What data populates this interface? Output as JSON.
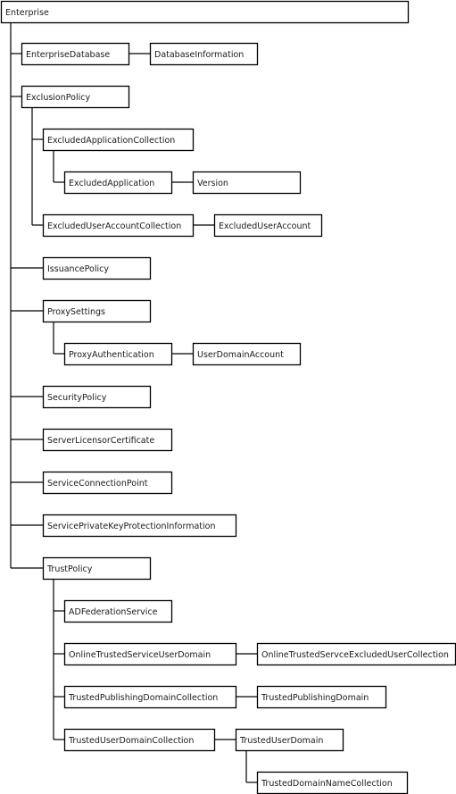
{
  "diagram": {
    "title": "Enterprise",
    "nodes": [
      {
        "id": "enterprise",
        "label": "Enterprise",
        "parent": null
      },
      {
        "id": "enterprise-database",
        "label": "EnterpriseDatabase",
        "parent": "enterprise"
      },
      {
        "id": "database-information",
        "label": "DatabaseInformation",
        "parent": "enterprise-database"
      },
      {
        "id": "exclusion-policy",
        "label": "ExclusionPolicy",
        "parent": "enterprise"
      },
      {
        "id": "excluded-application-collection",
        "label": "ExcludedApplicationCollection",
        "parent": "exclusion-policy"
      },
      {
        "id": "excluded-application",
        "label": "ExcludedApplication",
        "parent": "excluded-application-collection"
      },
      {
        "id": "version",
        "label": "Version",
        "parent": "excluded-application"
      },
      {
        "id": "excluded-user-account-collection",
        "label": "ExcludedUserAccountCollection",
        "parent": "exclusion-policy"
      },
      {
        "id": "excluded-user-account",
        "label": "ExcludedUserAccount",
        "parent": "excluded-user-account-collection"
      },
      {
        "id": "issuance-policy",
        "label": "IssuancePolicy",
        "parent": "enterprise"
      },
      {
        "id": "proxy-settings",
        "label": "ProxySettings",
        "parent": "enterprise"
      },
      {
        "id": "proxy-authentication",
        "label": "ProxyAuthentication",
        "parent": "proxy-settings"
      },
      {
        "id": "user-domain-account",
        "label": "UserDomainAccount",
        "parent": "proxy-authentication"
      },
      {
        "id": "security-policy",
        "label": "SecurityPolicy",
        "parent": "enterprise"
      },
      {
        "id": "server-licensor-certificate",
        "label": "ServerLicensorCertificate",
        "parent": "enterprise"
      },
      {
        "id": "service-connection-point",
        "label": "ServiceConnectionPoint",
        "parent": "enterprise"
      },
      {
        "id": "service-private-key-protection-information",
        "label": "ServicePrivateKeyProtectionInformation",
        "parent": "enterprise"
      },
      {
        "id": "trust-policy",
        "label": "TrustPolicy",
        "parent": "enterprise"
      },
      {
        "id": "ad-federation-service",
        "label": "ADFederationService",
        "parent": "trust-policy"
      },
      {
        "id": "online-trusted-service-user-domain",
        "label": "OnlineTrustedServiceUserDomain",
        "parent": "trust-policy"
      },
      {
        "id": "online-trusted-servce-excluded-user-collection",
        "label": "OnlineTrustedServceExcludedUserCollection",
        "parent": "online-trusted-service-user-domain"
      },
      {
        "id": "trusted-publishing-domain-collection",
        "label": "TrustedPublishingDomainCollection",
        "parent": "trust-policy"
      },
      {
        "id": "trusted-publishing-domain",
        "label": "TrustedPublishingDomain",
        "parent": "trusted-publishing-domain-collection"
      },
      {
        "id": "trusted-user-domain-collection",
        "label": "TrustedUserDomainCollection",
        "parent": "trust-policy"
      },
      {
        "id": "trusted-user-domain",
        "label": "TrustedUserDomain",
        "parent": "trusted-user-domain-collection"
      },
      {
        "id": "trusted-domain-name-collection",
        "label": "TrustedDomainNameCollection",
        "parent": "trusted-user-domain"
      }
    ]
  }
}
